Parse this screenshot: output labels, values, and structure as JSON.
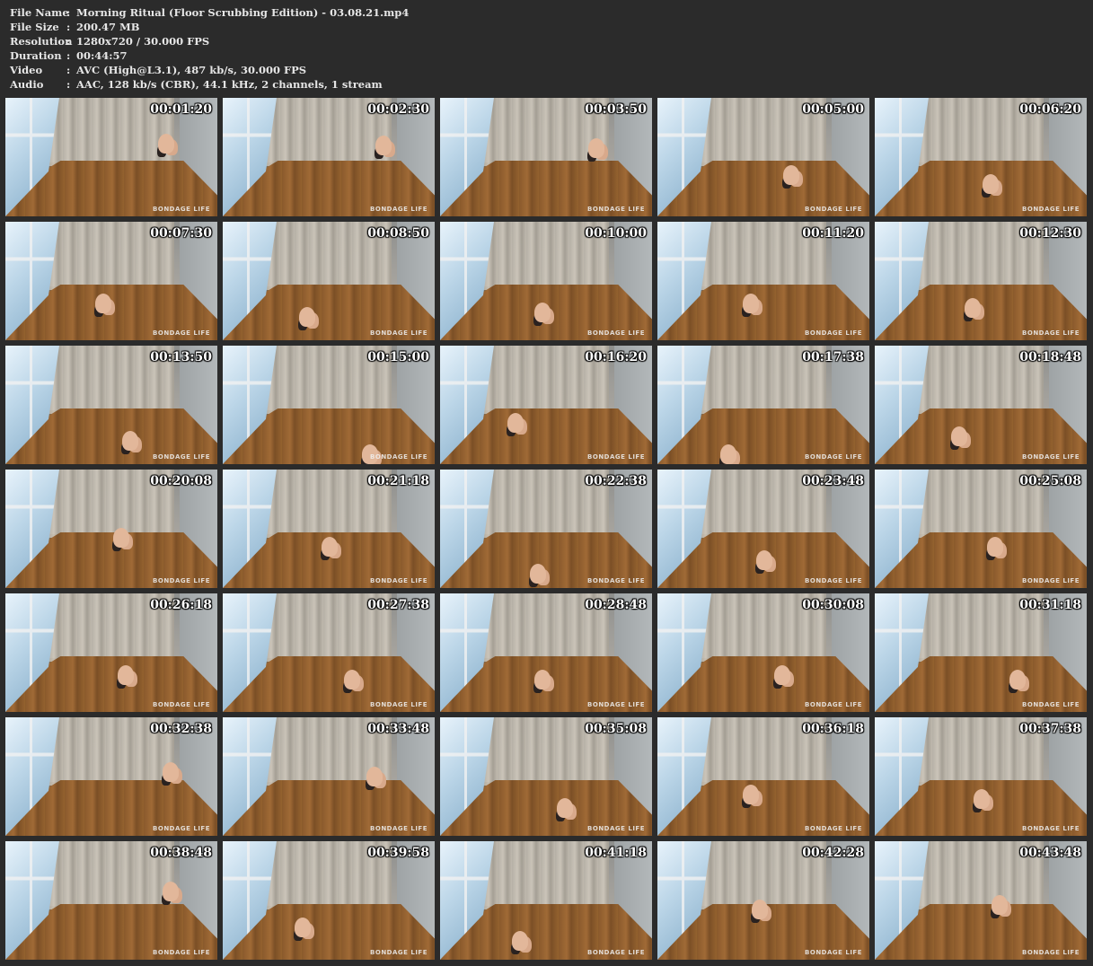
{
  "header": {
    "rows": [
      {
        "label": "File Name",
        "sep": ":",
        "value": "Morning Ritual (Floor Scrubbing Edition) - 03.08.21.mp4"
      },
      {
        "label": "File Size",
        "sep": ":",
        "value": "200.47 MB"
      },
      {
        "label": "Resolution",
        "sep": ":",
        "value": "1280x720 / 30.000 FPS"
      },
      {
        "label": "Duration",
        "sep": ":",
        "value": "00:44:57"
      },
      {
        "label": "Video",
        "sep": ":",
        "value": "AVC (High@L3.1), 487 kb/s, 30.000 FPS"
      },
      {
        "label": "Audio",
        "sep": ":",
        "value": "AAC, 128 kb/s (CBR), 44.1 kHz, 2 channels, 1 stream"
      }
    ]
  },
  "thumbnails": {
    "watermark": "BONDAGE LIFE",
    "timestamps": [
      "00:01:20",
      "00:02:30",
      "00:03:50",
      "00:05:00",
      "00:06:20",
      "00:07:30",
      "00:08:50",
      "00:10:00",
      "00:11:20",
      "00:12:30",
      "00:13:50",
      "00:15:00",
      "00:16:20",
      "00:17:38",
      "00:18:48",
      "00:20:08",
      "00:21:18",
      "00:22:38",
      "00:23:48",
      "00:25:08",
      "00:26:18",
      "00:27:38",
      "00:28:48",
      "00:30:08",
      "00:31:18",
      "00:32:38",
      "00:33:48",
      "00:35:08",
      "00:36:18",
      "00:37:38",
      "00:38:48",
      "00:39:58",
      "00:41:18",
      "00:42:28",
      "00:43:48"
    ]
  }
}
